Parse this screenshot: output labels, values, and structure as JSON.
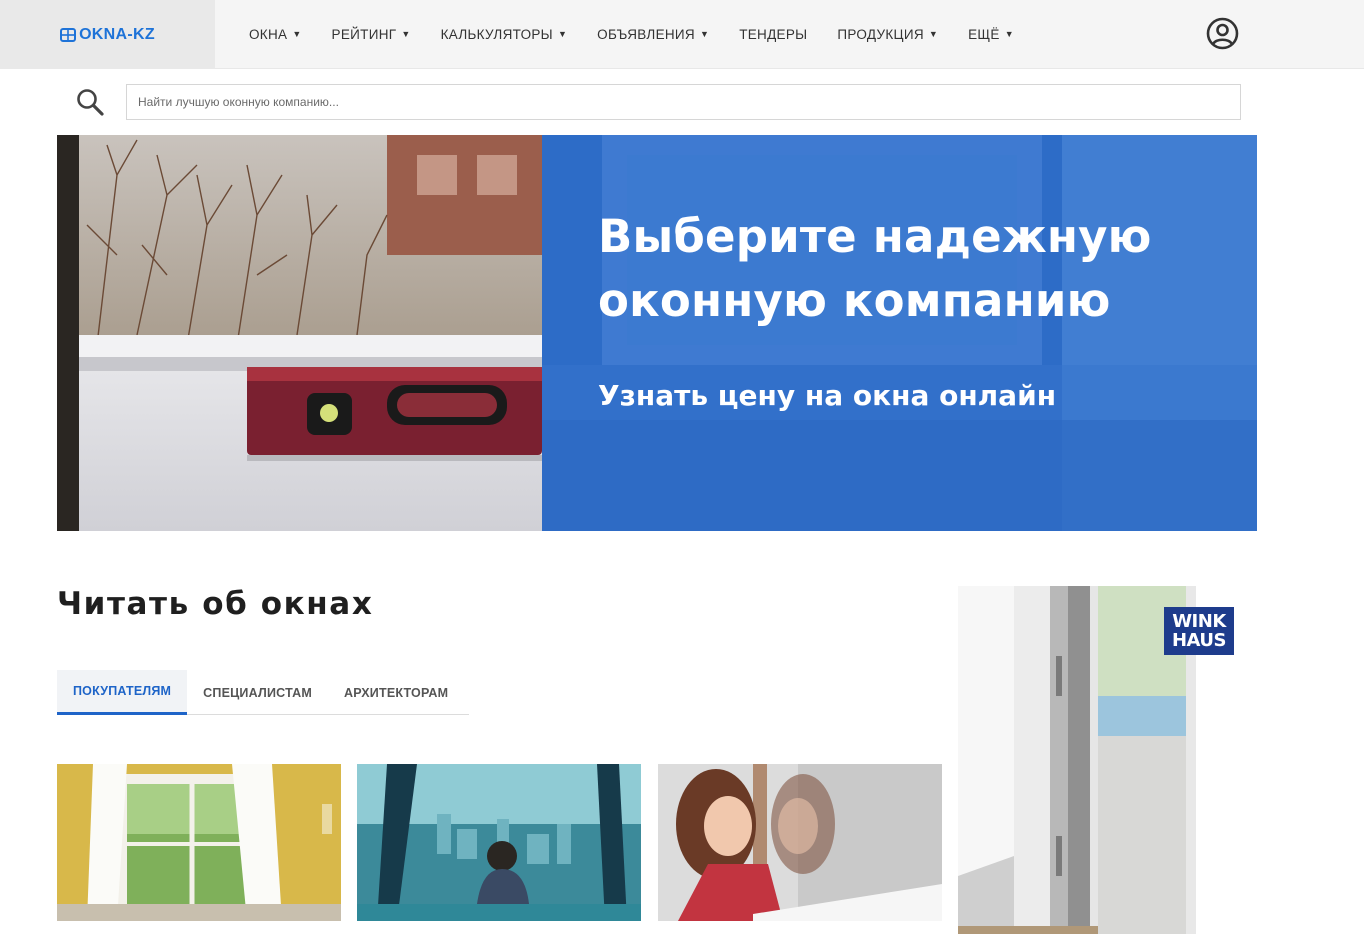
{
  "header": {
    "logo_text": "OKNA-KZ",
    "nav": [
      {
        "label": "ОКНА",
        "has_dropdown": true
      },
      {
        "label": "РЕЙТИНГ",
        "has_dropdown": true
      },
      {
        "label": "КАЛЬКУЛЯТОРЫ",
        "has_dropdown": true
      },
      {
        "label": "ОБЪЯВЛЕНИЯ",
        "has_dropdown": true
      },
      {
        "label": "ТЕНДЕРЫ",
        "has_dropdown": false
      },
      {
        "label": "ПРОДУКЦИЯ",
        "has_dropdown": true
      },
      {
        "label": "ЕЩЁ",
        "has_dropdown": true
      }
    ],
    "user_icon": "user-circle-icon"
  },
  "search": {
    "placeholder": "Найти лучшую оконную компанию...",
    "value": "",
    "icon": "search-icon"
  },
  "hero": {
    "title": "Выберите надежную оконную компанию",
    "subtitle": "Узнать цену на окна онлайн"
  },
  "section": {
    "title": "Читать об окнах",
    "tabs": [
      {
        "label": "ПОКУПАТЕЛЯМ",
        "active": true
      },
      {
        "label": "СПЕЦИАЛИСТАМ",
        "active": false
      },
      {
        "label": "АРХИТЕКТОРАМ",
        "active": false
      }
    ]
  },
  "ad": {
    "logo_line1": "WINK",
    "logo_line2": "HAUS"
  },
  "colors": {
    "accent": "#1e64c8",
    "logo_blue": "#1e73d8",
    "hero_blue": "#2a6cc6",
    "header_bg": "#f5f5f5"
  }
}
